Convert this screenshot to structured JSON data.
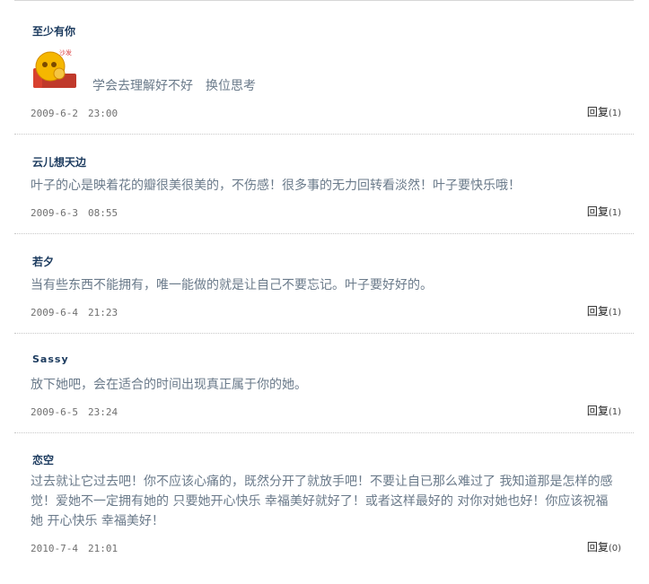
{
  "comments": [
    {
      "author": "至少有你",
      "text": "学会去理解好不好　换位思考",
      "date": "2009-6-2　23:00",
      "reply_label": "回复",
      "reply_count": "(1)",
      "emoticon_label": "沙发"
    },
    {
      "author": "云儿想天边",
      "text": "叶子的心是映着花的瓣很美很美的，不伤感！很多事的无力回转看淡然！叶子要快乐哦！",
      "date": "2009-6-3　08:55",
      "reply_label": "回复",
      "reply_count": "(1)"
    },
    {
      "author": "若夕",
      "text": "当有些东西不能拥有，唯一能做的就是让自己不要忘记。叶子要好好的。",
      "date": "2009-6-4　21:23",
      "reply_label": "回复",
      "reply_count": "(1)"
    },
    {
      "author": "Sassy",
      "text": "放下她吧，会在适合的时间出现真正属于你的她。",
      "date": "2009-6-5　23:24",
      "reply_label": "回复",
      "reply_count": "(1)"
    },
    {
      "author": "恋空",
      "text_lines": [
        "过去就让它过去吧！你不应该心痛的，既然分开了就放手吧！不要让自已那么难过了 我知道那是怎样的感",
        "觉！爱她不一定拥有她的 只要她开心快乐 幸福美好就好了！或者这样最好的 对你对她也好！你应该祝福",
        "她 开心快乐 幸福美好！"
      ],
      "date": "2010-7-4　21:01",
      "reply_label": "回复",
      "reply_count": "(0)"
    }
  ],
  "colors": {
    "author": "#1b3a5e",
    "body_text": "#6a7a8a",
    "date": "#6f6f6f",
    "separator": "#c8c8c8"
  }
}
